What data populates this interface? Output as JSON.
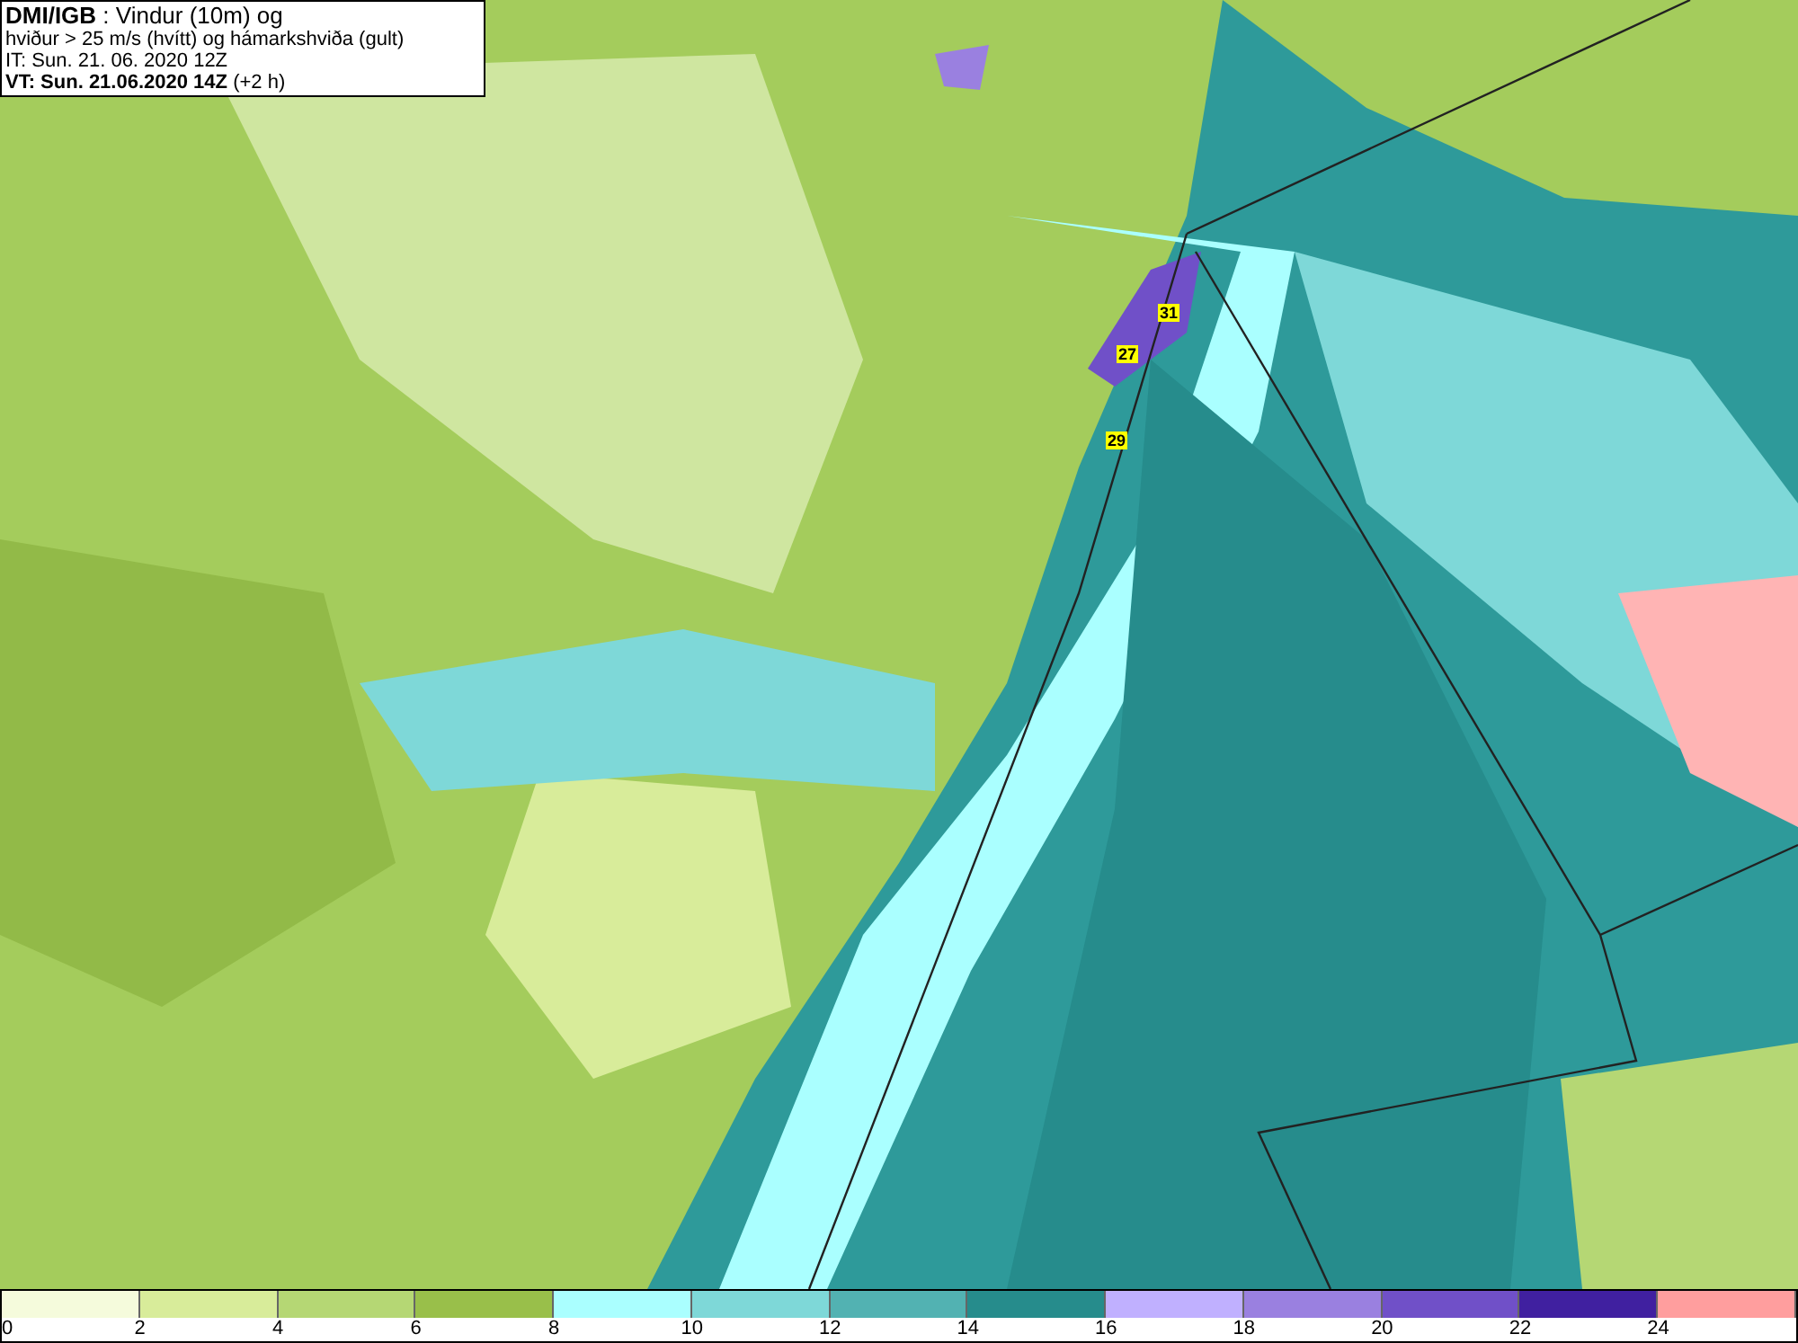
{
  "header": {
    "lines": [
      "**DMI/IGB** : Vindur (10m) og",
      "hviður > 25 m/s (hvítt) og hámarkshviða (gult)",
      "IT: Sun. 21. 06. 2020 12Z",
      "**VT: Sun. 21.06.2020 14Z** (+2 h)"
    ]
  },
  "map": {
    "gust_labels": [
      {
        "text": "31"
      },
      {
        "text": "27"
      },
      {
        "text": "29"
      }
    ]
  },
  "legend": {
    "segments": [
      {
        "color": "#f5fbdc"
      },
      {
        "color": "#d8ec9a"
      },
      {
        "color": "#b5d774"
      },
      {
        "color": "#99bf4a"
      },
      {
        "color": "#aaffff"
      },
      {
        "color": "#7ed8d8"
      },
      {
        "color": "#52b2b2"
      },
      {
        "color": "#268c8c"
      },
      {
        "color": "#c0b0ff"
      },
      {
        "color": "#9a80e0"
      },
      {
        "color": "#7050c8"
      },
      {
        "color": "#4020a0"
      },
      {
        "color": "#ff9e9e"
      }
    ],
    "ticks": [
      "0",
      "2",
      "4",
      "6",
      "8",
      "10",
      "12",
      "14",
      "16",
      "18",
      "20",
      "22",
      "24"
    ]
  }
}
